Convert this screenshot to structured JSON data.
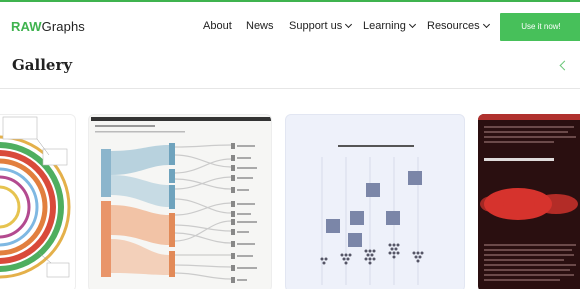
{
  "brand": {
    "raw": "RAW",
    "graphs": "Graphs"
  },
  "nav": {
    "items": [
      {
        "label": "About",
        "dropdown": false
      },
      {
        "label": "News",
        "dropdown": false
      },
      {
        "label": "Support us",
        "dropdown": true
      },
      {
        "label": "Learning",
        "dropdown": true
      },
      {
        "label": "Resources",
        "dropdown": true
      }
    ],
    "cta_label": "Use it now!"
  },
  "page": {
    "title": "Gallery"
  },
  "colors": {
    "brand_green": "#3fb34f",
    "button_green": "#47c05a",
    "arrow_green": "#6cc77a"
  },
  "icons": {
    "dropdown": "chevron-down-icon",
    "carousel_prev": "chevron-left-icon"
  },
  "gallery": {
    "cards": [
      {
        "thumb": "circular-radial-chart"
      },
      {
        "thumb": "alluvial-diagram"
      },
      {
        "thumb": "beeswarm-portraits"
      },
      {
        "thumb": "dark-article-blob"
      }
    ]
  }
}
